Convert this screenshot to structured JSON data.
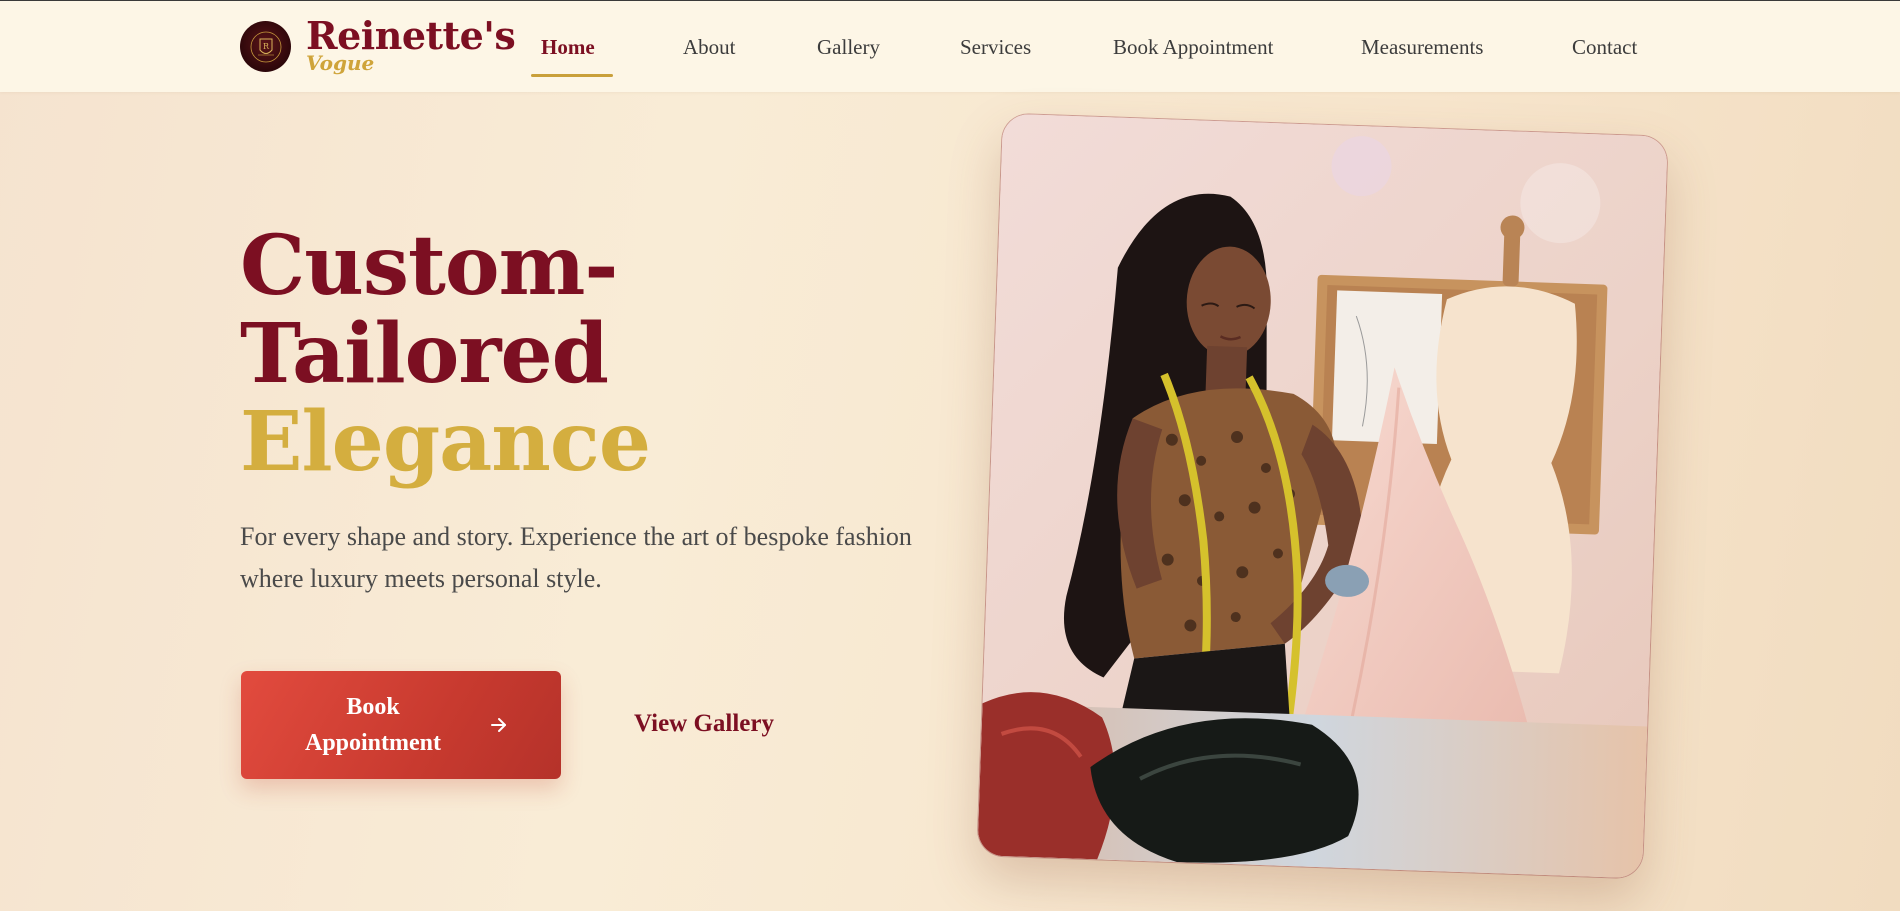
{
  "brand": {
    "name": "Reinette's",
    "tagline": "Vogue",
    "logo_icon": "crest-logo-icon"
  },
  "nav": {
    "items": [
      {
        "label": "Home",
        "active": true
      },
      {
        "label": "About",
        "active": false
      },
      {
        "label": "Gallery",
        "active": false
      },
      {
        "label": "Services",
        "active": false
      },
      {
        "label": "Book Appointment",
        "active": false
      },
      {
        "label": "Measurements",
        "active": false
      },
      {
        "label": "Contact",
        "active": false
      }
    ]
  },
  "hero": {
    "headline_line1": "Custom-",
    "headline_line2": "Tailored",
    "headline_line3": "Elegance",
    "subtitle": "For every shape and story. Experience the art of bespoke fashion where luxury meets personal style.",
    "primary_button": "Book Appointment",
    "primary_button_icon": "arrow-right-icon",
    "secondary_button": "View Gallery",
    "image_subject": "seamstress-draping-fabric-on-dress-form"
  },
  "colors": {
    "burgundy": "#7c0f22",
    "gold": "#d4ae3f",
    "button_red": "#d5443a",
    "header_bg": "#fdf6e6"
  }
}
